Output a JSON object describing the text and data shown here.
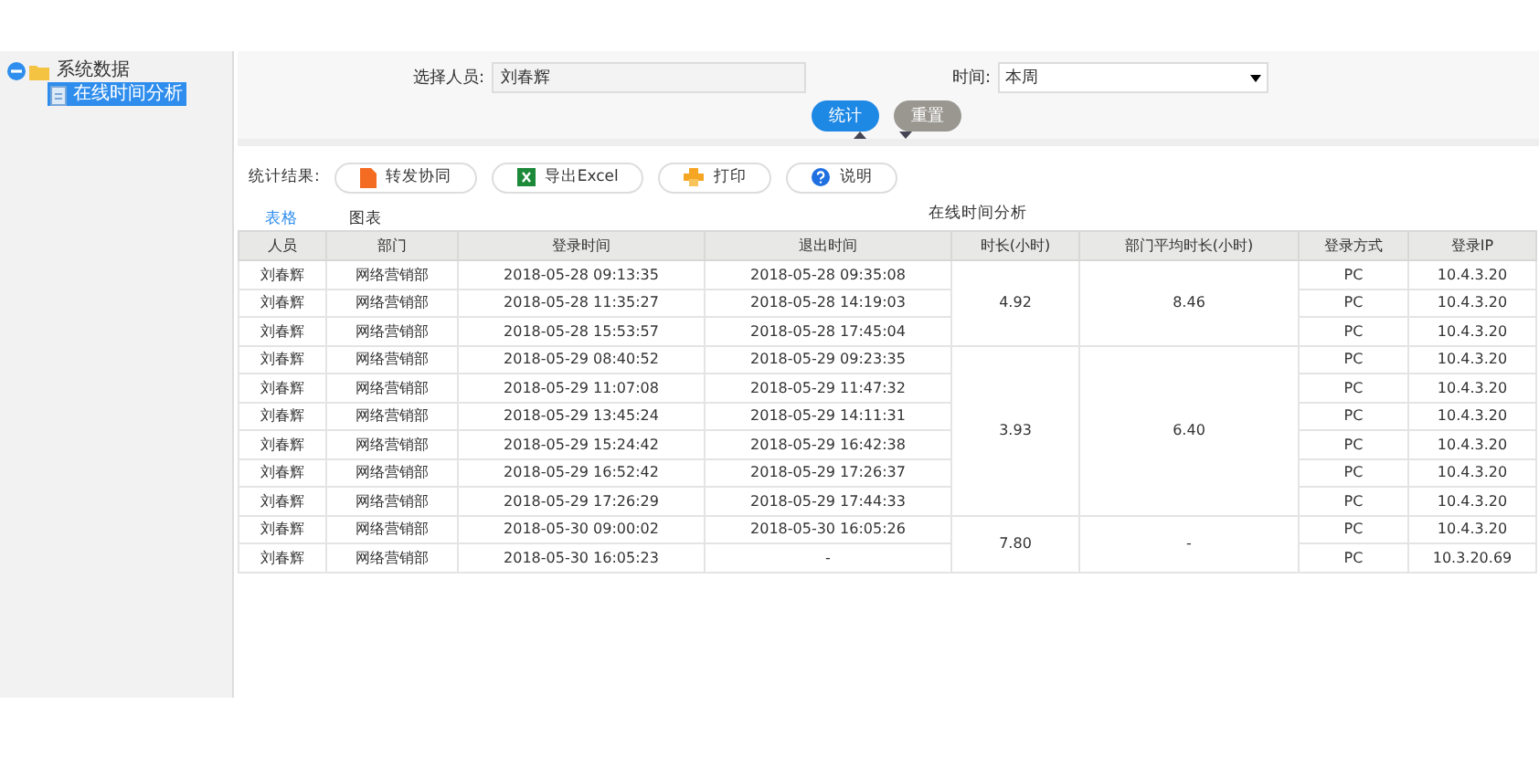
{
  "sidebar": {
    "tree": [
      {
        "label": "系统数据",
        "expanded": true,
        "children": [
          {
            "label": "在线时间分析",
            "selected": true
          }
        ]
      }
    ]
  },
  "filters": {
    "person": {
      "label": "选择人员:",
      "value": "刘春辉"
    },
    "time": {
      "label": "时间:",
      "value": "本周"
    },
    "buttons": [
      {
        "label": "统计",
        "kind": "primary"
      },
      {
        "label": "重置",
        "kind": "secondary"
      }
    ]
  },
  "toolbar": {
    "label": "统计结果:",
    "buttons": [
      {
        "label": "转发协同",
        "kind": "forward"
      },
      {
        "label": "导出Excel",
        "kind": "excel"
      },
      {
        "label": "打印",
        "kind": "print"
      },
      {
        "label": "说明",
        "kind": "help"
      }
    ]
  },
  "tabs": [
    {
      "label": "表格",
      "selected": true
    },
    {
      "label": "图表",
      "selected": false
    }
  ],
  "table": {
    "title": "在线时间分析",
    "columns": [
      "人员",
      "部门",
      "登录时间",
      "退出时间",
      "时长(小时)",
      "部门平均时长(小时)",
      "登录方式",
      "登录IP"
    ],
    "groups": [
      {
        "duration": "4.92",
        "dept_avg": "8.46",
        "rows": [
          [
            "刘春辉",
            "网络营销部",
            "2018-05-28 09:13:35",
            "2018-05-28 09:35:08",
            "PC",
            "10.4.3.20"
          ],
          [
            "刘春辉",
            "网络营销部",
            "2018-05-28 11:35:27",
            "2018-05-28 14:19:03",
            "PC",
            "10.4.3.20"
          ],
          [
            "刘春辉",
            "网络营销部",
            "2018-05-28 15:53:57",
            "2018-05-28 17:45:04",
            "PC",
            "10.4.3.20"
          ]
        ]
      },
      {
        "duration": "3.93",
        "dept_avg": "6.40",
        "rows": [
          [
            "刘春辉",
            "网络营销部",
            "2018-05-29 08:40:52",
            "2018-05-29 09:23:35",
            "PC",
            "10.4.3.20"
          ],
          [
            "刘春辉",
            "网络营销部",
            "2018-05-29 11:07:08",
            "2018-05-29 11:47:32",
            "PC",
            "10.4.3.20"
          ],
          [
            "刘春辉",
            "网络营销部",
            "2018-05-29 13:45:24",
            "2018-05-29 14:11:31",
            "PC",
            "10.4.3.20"
          ],
          [
            "刘春辉",
            "网络营销部",
            "2018-05-29 15:24:42",
            "2018-05-29 16:42:38",
            "PC",
            "10.4.3.20"
          ],
          [
            "刘春辉",
            "网络营销部",
            "2018-05-29 16:52:42",
            "2018-05-29 17:26:37",
            "PC",
            "10.4.3.20"
          ],
          [
            "刘春辉",
            "网络营销部",
            "2018-05-29 17:26:29",
            "2018-05-29 17:44:33",
            "PC",
            "10.4.3.20"
          ]
        ]
      },
      {
        "duration": "7.80",
        "dept_avg": "-",
        "rows": [
          [
            "刘春辉",
            "网络营销部",
            "2018-05-30 09:00:02",
            "2018-05-30 16:05:26",
            "PC",
            "10.4.3.20"
          ],
          [
            "刘春辉",
            "网络营销部",
            "2018-05-30 16:05:23",
            "-",
            "PC",
            "10.3.20.69"
          ]
        ]
      }
    ]
  }
}
